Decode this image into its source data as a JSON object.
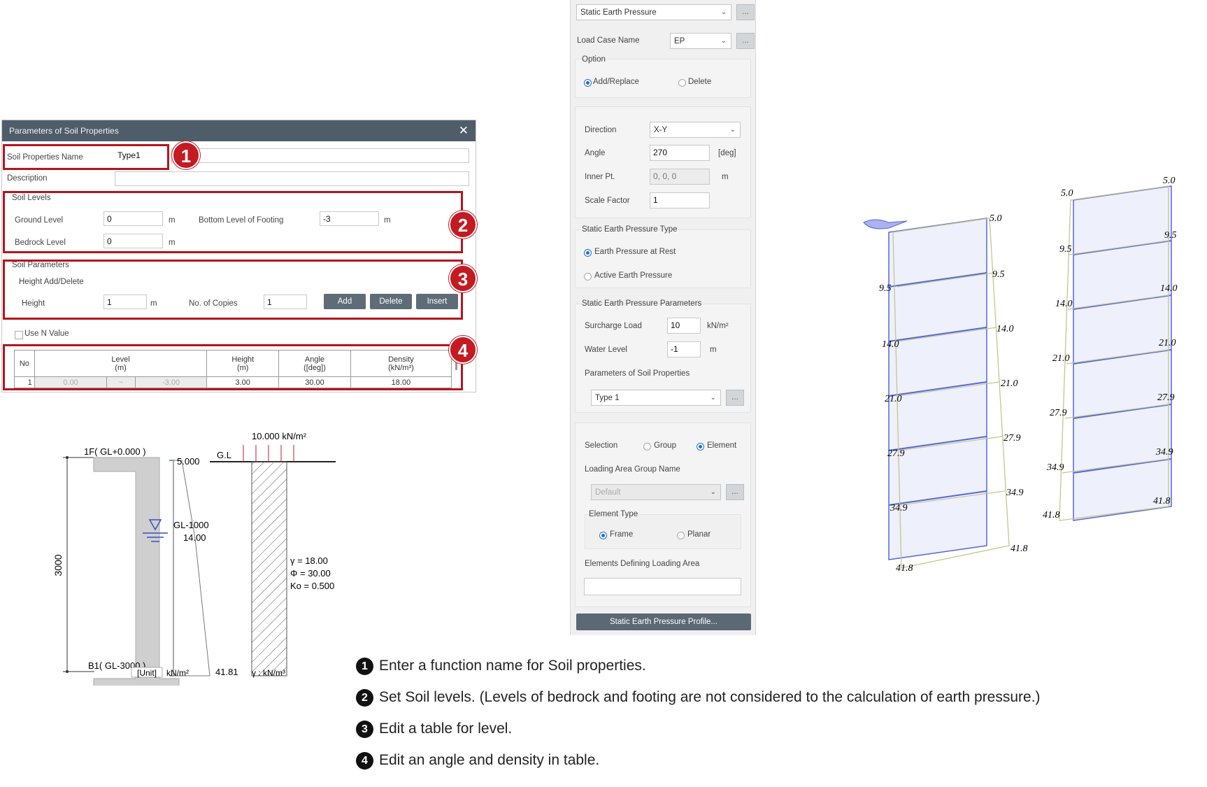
{
  "dialog": {
    "title": "Parameters of Soil Properties",
    "close_glyph": "✕",
    "soil_name_label": "Soil Properties Name",
    "soil_name_value": "Type1",
    "description_label": "Description",
    "description_value": "",
    "soil_levels_title": "Soil Levels",
    "ground_level_label": "Ground Level",
    "ground_level_value": "0",
    "bottom_footing_label": "Bottom Level of Footing",
    "bottom_footing_value": "-3",
    "bedrock_label": "Bedrock Level",
    "bedrock_value": "0",
    "unit_m": "m",
    "soil_params_title": "Soil Parameters",
    "height_add_title": "Height Add/Delete",
    "height_label": "Height",
    "height_value": "1",
    "copies_label": "No. of Copies",
    "copies_value": "1",
    "add_btn": "Add",
    "delete_btn": "Delete",
    "insert_btn": "Insert",
    "use_n_label": "Use N Value",
    "table": {
      "headers": [
        "No",
        "Level\n(m)",
        "Height\n(m)",
        "Angle\n([deg])",
        "Density\n(kN/m³)"
      ],
      "row": {
        "no": "1",
        "level_from": "0.00",
        "tilde": "~",
        "level_to": "-3.00",
        "height": "3.00",
        "angle": "30.00",
        "density": "18.00"
      }
    },
    "badges": [
      "1",
      "2",
      "3",
      "4"
    ]
  },
  "diagram": {
    "surcharge": "10.000 kN/m²",
    "gl": "G.L",
    "top_level": "1F( GL+0.000 )",
    "bottom_level": "B1( GL-3000 )",
    "height_dim": "3000",
    "p_top": "5.000",
    "water": "GL-1000",
    "p_water": "14.00",
    "p_bottom": "41.81",
    "unit_box": "[Unit]",
    "unit_kn": "kN/m²",
    "gamma": "γ = 18.00",
    "phi": "Φ = 30.00",
    "ko": "Ko = 0.500",
    "gamma_unit": "γ : kN/m³"
  },
  "panel": {
    "type_select": "Static Earth Pressure",
    "load_case_label": "Load Case Name",
    "load_case_value": "EP",
    "option_title": "Option",
    "add_replace": "Add/Replace",
    "delete": "Delete",
    "direction_label": "Direction",
    "direction_value": "X-Y",
    "angle_label": "Angle",
    "angle_value": "270",
    "angle_unit": "[deg]",
    "inner_label": "Inner Pt.",
    "inner_value": "0, 0, 0",
    "unit_m": "m",
    "scale_label": "Scale Factor",
    "scale_value": "1",
    "sep_type_title": "Static Earth Pressure Type",
    "at_rest": "Earth Pressure at Rest",
    "active": "Active Earth Pressure",
    "sep_params_title": "Static Earth Pressure Parameters",
    "surcharge_label": "Surcharge Load",
    "surcharge_value": "10",
    "surcharge_unit": "kN/m²",
    "water_label": "Water Level",
    "water_value": "-1",
    "soil_params_label": "Parameters of Soil Properties",
    "soil_params_value": "Type 1",
    "selection_label": "Selection",
    "group": "Group",
    "element": "Element",
    "loading_group_label": "Loading Area Group Name",
    "loading_group_value": "Default",
    "element_type_title": "Element Type",
    "frame": "Frame",
    "planar": "Planar",
    "elements_def_label": "Elements Defining Loading Area",
    "profile_btn": "Static Earth Pressure Profile...",
    "dots": "..."
  },
  "model": {
    "left_labels": [
      "5.0",
      "9.5",
      "14.0",
      "21.0",
      "27.9",
      "34.9",
      "41.8"
    ],
    "right_labels": [
      "5.0",
      "9.5",
      "14.0",
      "21.0",
      "27.9",
      "34.9",
      "41.8"
    ]
  },
  "instructions": [
    {
      "num": "1",
      "text": "Enter a function name for Soil properties."
    },
    {
      "num": "2",
      "text": "Set Soil levels. (Levels of bedrock and footing are not considered to the calculation of earth pressure.)"
    },
    {
      "num": "3",
      "text": "Edit a table for level."
    },
    {
      "num": "4",
      "text": "Edit an angle and density in table."
    }
  ],
  "colors": {
    "highlight": "#b3161e",
    "badge": "#c41a22",
    "title_bar": "#4f5d6a",
    "accent_blue": "#1e6fd6"
  }
}
